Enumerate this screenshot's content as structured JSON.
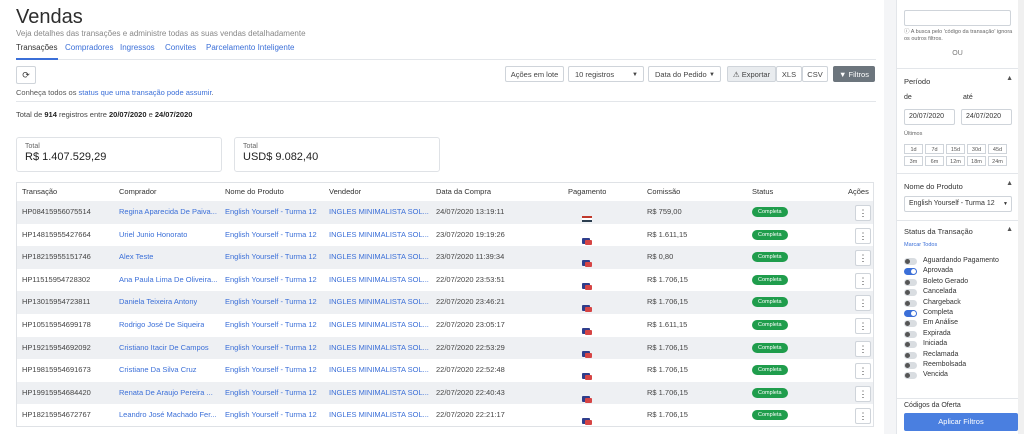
{
  "header": {
    "title": "Vendas",
    "subtitle": "Veja detalhes das transações e administre todas as suas vendas detalhadamente"
  },
  "tabs": [
    {
      "label": "Transações"
    },
    {
      "label": "Compradores"
    },
    {
      "label": "Ingressos"
    },
    {
      "label": "Convites"
    },
    {
      "label": "Parcelamento Inteligente"
    }
  ],
  "toolbar": {
    "bulk_label": "Ações em lote",
    "per_page": "10 registros",
    "sort": "Data do Pedido",
    "export": "Exportar",
    "xls": "XLS",
    "csv": "CSV",
    "filters": "Filtros"
  },
  "info": {
    "prefix": "Conheça todos os ",
    "link": "status que uma transação pode assumir",
    "suffix": "."
  },
  "totals": {
    "prefix": "Total de ",
    "count": "914",
    "mid": " registros entre ",
    "start": "20/07/2020",
    "and": " e ",
    "end": "24/07/2020"
  },
  "cards": [
    {
      "label": "Total",
      "value": "R$ 1.407.529,29"
    },
    {
      "label": "Total",
      "value": "USD$ 9.082,40"
    }
  ],
  "columns": [
    "Transação",
    "Comprador",
    "Nome do Produto",
    "Vendedor",
    "Data da Compra",
    "Pagamento",
    "Comissão",
    "Status",
    "Ações"
  ],
  "rows": [
    {
      "id": "HP08415956075514",
      "buyer": "Regina Aparecida De Paiva...",
      "product": "English Yourself - Turma 12",
      "seller": "INGLES MINIMALISTA SOL...",
      "date": "24/07/2020 13:19:11",
      "commission": "R$ 759,00",
      "status": "Completa",
      "pay": "flag"
    },
    {
      "id": "HP14815955427664",
      "buyer": "Uriel Junio Honorato",
      "product": "English Yourself - Turma 12",
      "seller": "INGLES MINIMALISTA SOL...",
      "date": "23/07/2020 19:19:26",
      "commission": "R$ 1.611,15",
      "status": "Completa",
      "pay": "card"
    },
    {
      "id": "HP18215955151746",
      "buyer": "Alex Teste",
      "product": "English Yourself - Turma 12",
      "seller": "INGLES MINIMALISTA SOL...",
      "date": "23/07/2020 11:39:34",
      "commission": "R$ 0,80",
      "status": "Completa",
      "pay": "card"
    },
    {
      "id": "HP11515954728302",
      "buyer": "Ana Paula Lima De Oliveira...",
      "product": "English Yourself - Turma 12",
      "seller": "INGLES MINIMALISTA SOL...",
      "date": "22/07/2020 23:53:51",
      "commission": "R$ 1.706,15",
      "status": "Completa",
      "pay": "card"
    },
    {
      "id": "HP13015954723811",
      "buyer": "Daniela Teixeira Antony",
      "product": "English Yourself - Turma 12",
      "seller": "INGLES MINIMALISTA SOL...",
      "date": "22/07/2020 23:46:21",
      "commission": "R$ 1.706,15",
      "status": "Completa",
      "pay": "card"
    },
    {
      "id": "HP10515954699178",
      "buyer": "Rodrigo José De Siqueira",
      "product": "English Yourself - Turma 12",
      "seller": "INGLES MINIMALISTA SOL...",
      "date": "22/07/2020 23:05:17",
      "commission": "R$ 1.611,15",
      "status": "Completa",
      "pay": "card"
    },
    {
      "id": "HP19215954692092",
      "buyer": "Cristiano Itacir De Campos",
      "product": "English Yourself - Turma 12",
      "seller": "INGLES MINIMALISTA SOL...",
      "date": "22/07/2020 22:53:29",
      "commission": "R$ 1.706,15",
      "status": "Completa",
      "pay": "card"
    },
    {
      "id": "HP19815954691673",
      "buyer": "Cristiane Da Silva Cruz",
      "product": "English Yourself - Turma 12",
      "seller": "INGLES MINIMALISTA SOL...",
      "date": "22/07/2020 22:52:48",
      "commission": "R$ 1.706,15",
      "status": "Completa",
      "pay": "card"
    },
    {
      "id": "HP19915954684420",
      "buyer": "Renata De Araujo Pereira ...",
      "product": "English Yourself - Turma 12",
      "seller": "INGLES MINIMALISTA SOL...",
      "date": "22/07/2020 22:40:43",
      "commission": "R$ 1.706,15",
      "status": "Completa",
      "pay": "card"
    },
    {
      "id": "HP18215954672767",
      "buyer": "Leandro José Machado Fer...",
      "product": "English Yourself - Turma 12",
      "seller": "INGLES MINIMALISTA SOL...",
      "date": "22/07/2020 22:21:17",
      "commission": "R$ 1.706,15",
      "status": "Completa",
      "pay": "card"
    }
  ],
  "sidebar": {
    "search_hint": "A busca pelo 'código da transação' ignora os outros filtros.",
    "or": "OU",
    "period": {
      "title": "Período",
      "from_label": "de",
      "to_label": "até",
      "from": "20/07/2020",
      "to": "24/07/2020",
      "last_label": "Últimos",
      "quick": [
        "1d",
        "7d",
        "15d",
        "30d",
        "45d",
        "3m",
        "6m",
        "12m",
        "18m",
        "24m"
      ]
    },
    "product": {
      "title": "Nome do Produto",
      "value": "English Yourself - Turma 12"
    },
    "status": {
      "title": "Status da Transação",
      "mark_all": "Marcar Todos",
      "items": [
        {
          "label": "Aguardando Pagamento",
          "on": false
        },
        {
          "label": "Aprovada",
          "on": true
        },
        {
          "label": "Boleto Gerado",
          "on": false
        },
        {
          "label": "Cancelada",
          "on": false
        },
        {
          "label": "Chargeback",
          "on": false
        },
        {
          "label": "Completa",
          "on": true
        },
        {
          "label": "Em Análise",
          "on": false
        },
        {
          "label": "Expirada",
          "on": false
        },
        {
          "label": "Iniciada",
          "on": false
        },
        {
          "label": "Reclamada",
          "on": false
        },
        {
          "label": "Reembolsada",
          "on": false
        },
        {
          "label": "Vencida",
          "on": false
        }
      ]
    },
    "offer_title": "Códigos da Oferta",
    "apply": "Aplicar Filtros"
  },
  "colors": {
    "accent": "#3b6fd8",
    "success": "#1f9d4c"
  }
}
